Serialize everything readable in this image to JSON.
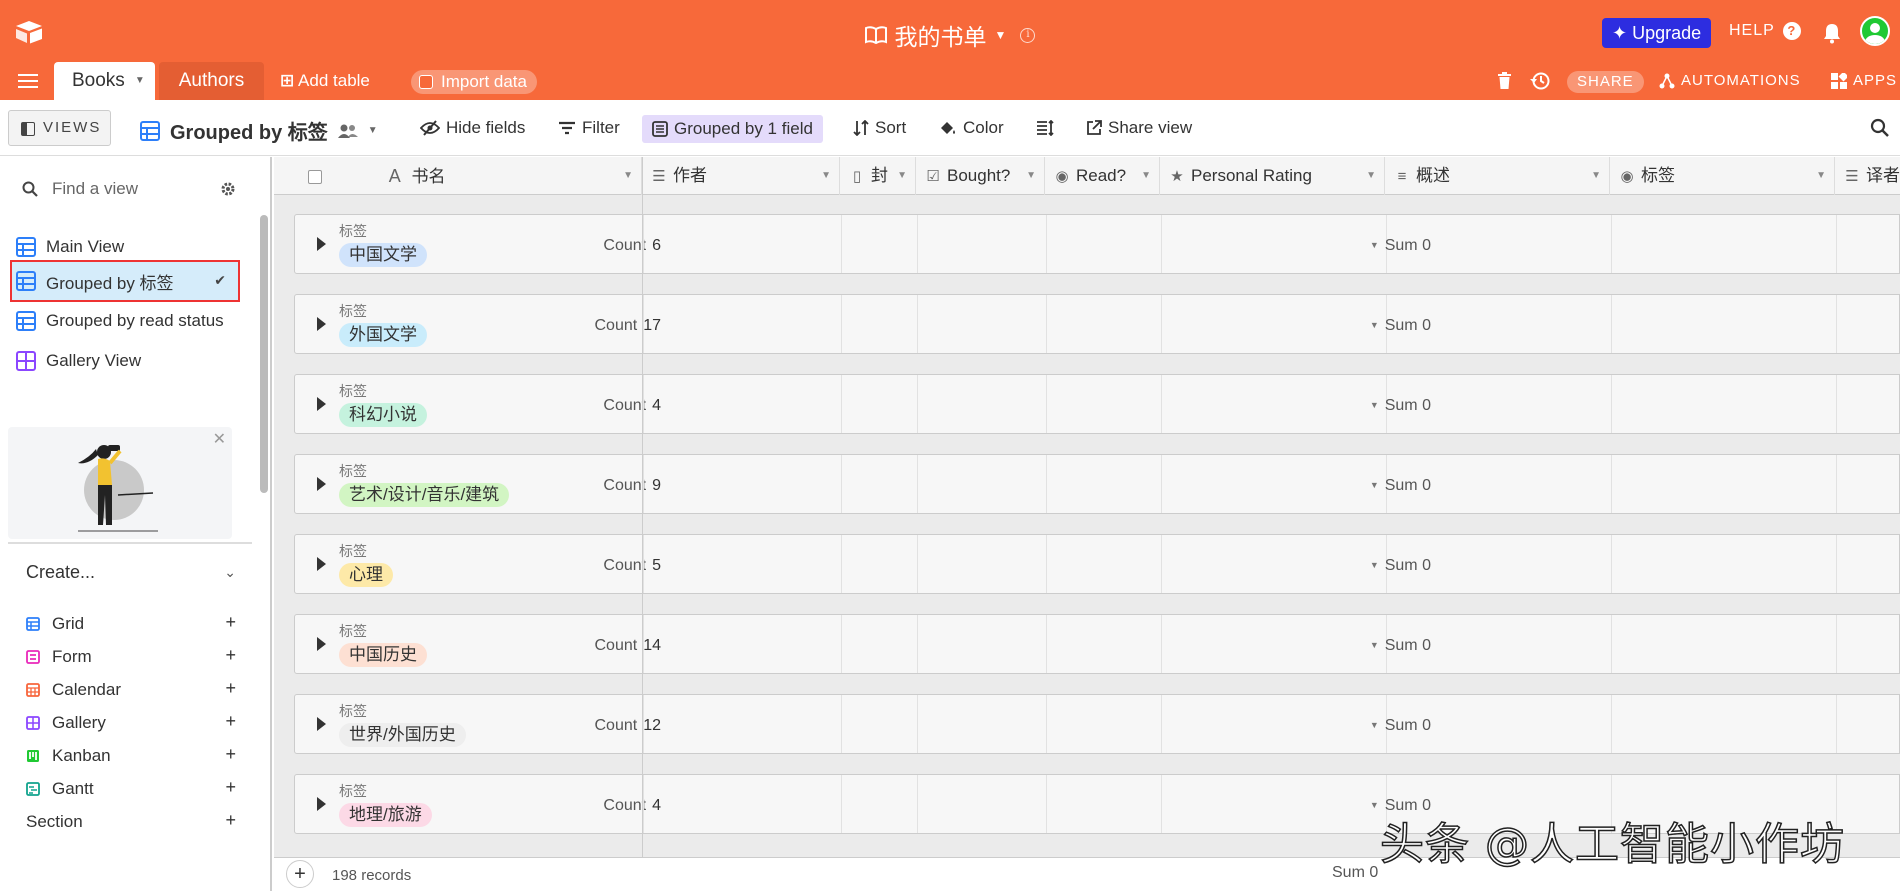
{
  "topbar": {
    "base_title": "我的书单",
    "upgrade_label": "Upgrade",
    "help_label": "HELP",
    "share_label": "SHARE",
    "automations_label": "AUTOMATIONS",
    "apps_label": "APPS"
  },
  "tabs": {
    "active": "Books",
    "other": "Authors",
    "add_table": "Add table",
    "import_data": "Import data"
  },
  "viewbar": {
    "views_label": "VIEWS",
    "view_name": "Grouped by 标签",
    "hide_fields": "Hide fields",
    "filter": "Filter",
    "grouped": "Grouped by 1 field",
    "sort": "Sort",
    "color": "Color",
    "share_view": "Share view"
  },
  "sidebar": {
    "find_placeholder": "Find a view",
    "views": [
      {
        "label": "Main View"
      },
      {
        "label": "Grouped by 标签"
      },
      {
        "label": "Grouped by read status"
      },
      {
        "label": "Gallery View"
      }
    ],
    "create_label": "Create...",
    "create_items": [
      {
        "label": "Grid"
      },
      {
        "label": "Form"
      },
      {
        "label": "Calendar"
      },
      {
        "label": "Gallery"
      },
      {
        "label": "Kanban"
      },
      {
        "label": "Gantt"
      },
      {
        "label": "Section"
      }
    ]
  },
  "grid": {
    "columns": [
      "书名",
      "作者",
      "封",
      "Bought?",
      "Read?",
      "Personal Rating",
      "概述",
      "标签",
      "译者"
    ],
    "group_field": "标签",
    "count_label": "Count",
    "sum_label": "Sum",
    "groups": [
      {
        "tag": "中国文学",
        "count": "6",
        "sum": "0",
        "color": "#d0e3fb"
      },
      {
        "tag": "外国文学",
        "count": "17",
        "sum": "0",
        "color": "#c9ecfb"
      },
      {
        "tag": "科幻小说",
        "count": "4",
        "sum": "0",
        "color": "#c5f2de"
      },
      {
        "tag": "艺术/设计/音乐/建筑",
        "count": "9",
        "sum": "0",
        "color": "#d2f5c3"
      },
      {
        "tag": "心理",
        "count": "5",
        "sum": "0",
        "color": "#fde9a8"
      },
      {
        "tag": "中国历史",
        "count": "14",
        "sum": "0",
        "color": "#fde0d3"
      },
      {
        "tag": "世界/外国历史",
        "count": "12",
        "sum": "0",
        "color": "#eeeeee"
      },
      {
        "tag": "地理/旅游",
        "count": "4",
        "sum": "0",
        "color": "#fcd9e6"
      }
    ],
    "records_label": "198 records",
    "footer_sum": "Sum 0"
  },
  "watermark": "头条 @人工智能小作坊"
}
